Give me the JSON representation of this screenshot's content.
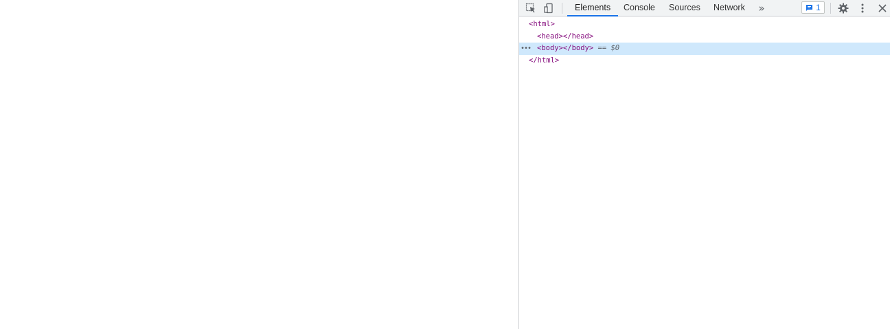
{
  "devtools": {
    "toolbar": {
      "tabs": [
        {
          "label": "Elements",
          "active": true
        },
        {
          "label": "Console",
          "active": false
        },
        {
          "label": "Sources",
          "active": false
        },
        {
          "label": "Network",
          "active": false
        }
      ],
      "more_tabs_glyph": "»",
      "issues_count": "1",
      "icons": [
        "inspect-element-icon",
        "device-toolbar-icon",
        "issues-icon",
        "settings-gear-icon",
        "more-vertical-icon",
        "close-icon"
      ]
    },
    "dom_tree": {
      "html_open": "<html>",
      "head": "<head></head>",
      "body": "<body></body>",
      "selected_marker": "== $0",
      "html_close": "</html>",
      "row_menu_glyph": "•••"
    },
    "colors": {
      "accent": "#1a73e8",
      "selected_row": "#cfe8fc",
      "tag": "#881280",
      "toolbar_bg": "#f1f3f4"
    }
  }
}
